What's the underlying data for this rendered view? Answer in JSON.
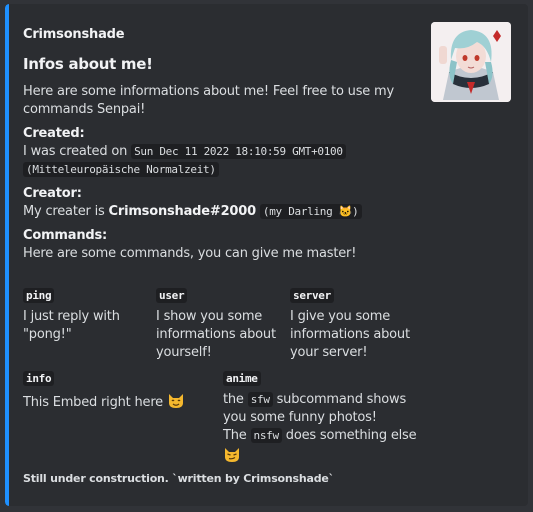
{
  "colors": {
    "accent": "#1e90ff",
    "background": "#2b2d31",
    "code_bg": "#1e1f22"
  },
  "embed": {
    "author": "Crimsonshade",
    "title": "Infos about me!",
    "thumbnail": "anime-girl-avatar",
    "description": {
      "intro": "Here are some informations about me! Feel free to use my commands Senpai!",
      "created_heading": "Created:",
      "created_prefix": "I was created on",
      "created_code_1": "Sun Dec 11 2022 18:10:59 GMT+0100",
      "created_code_2": "(Mitteleuropäische Normalzeit)",
      "creator_heading": "Creator:",
      "creator_prefix": "My creater is",
      "creator_name": "Crimsonshade#2000",
      "creator_code": "(my Darling 🐱)",
      "commands_heading": "Commands:",
      "commands_intro": "Here are some commands, you can give me master!"
    },
    "fields": [
      {
        "name": "ping",
        "value": "I just reply with \"pong!\""
      },
      {
        "name": "user",
        "value": "I show you some informations about yourself!"
      },
      {
        "name": "server",
        "value": "I give you some informations about your server!"
      },
      {
        "name": "info",
        "value": "This Embed right here"
      },
      {
        "name": "anime",
        "value_1": "the",
        "code_1": "sfw",
        "value_2": "subcommand shows you some funny photos!",
        "value_3": "The",
        "code_2": "nsfw",
        "value_4": "does something else"
      }
    ],
    "footer": "Still under construction. `written by Crimsonshade`"
  }
}
